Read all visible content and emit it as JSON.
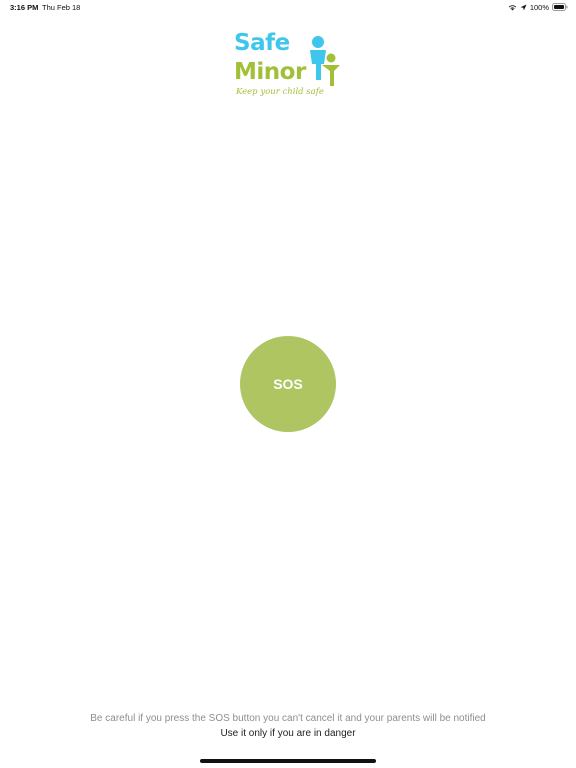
{
  "status_bar": {
    "time": "3:16 PM",
    "date": "Thu Feb 18",
    "battery": "100%",
    "icons": [
      "wifi-icon",
      "location-arrow-icon",
      "battery-icon"
    ]
  },
  "logo": {
    "word1": "Safe",
    "word2": "Minor",
    "tagline": "Keep your child safe",
    "colors": {
      "blue": "#3ec6ec",
      "green": "#a2c037"
    }
  },
  "sos": {
    "label": "SOS",
    "color": "#afc562"
  },
  "footer": {
    "warning": "Be careful if you press the SOS button you can't cancel it and your parents will be notified",
    "note": "Use it only if you are in danger"
  }
}
